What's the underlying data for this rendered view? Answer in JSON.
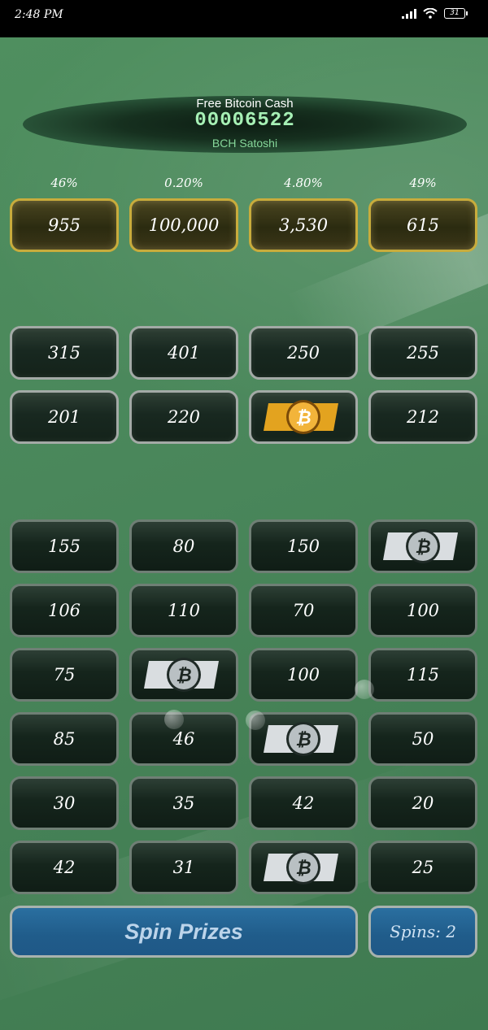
{
  "status_bar": {
    "time": "2:48 PM",
    "battery": "31"
  },
  "header": {
    "title": "Free Bitcoin Cash",
    "amount": "00006522",
    "unit": "BCH Satoshi"
  },
  "top_prizes": [
    {
      "percent": "46%",
      "value": "955"
    },
    {
      "percent": "0.20%",
      "value": "100,000"
    },
    {
      "percent": "4.80%",
      "value": "3,530"
    },
    {
      "percent": "49%",
      "value": "615"
    }
  ],
  "silver_rows": [
    [
      "315",
      "401",
      "250",
      "255"
    ],
    [
      "201",
      "220",
      "gold-bch-coin",
      "212"
    ]
  ],
  "grid_rows": [
    [
      "155",
      "80",
      "150",
      "bch-coin"
    ],
    [
      "106",
      "110",
      "70",
      "100"
    ],
    [
      "75",
      "bch-coin",
      "100",
      "115"
    ],
    [
      "85",
      "46",
      "bch-coin",
      "50"
    ],
    [
      "30",
      "35",
      "42",
      "20"
    ],
    [
      "42",
      "31",
      "bch-coin",
      "25"
    ]
  ],
  "buttons": {
    "spin_label": "Spin Prizes",
    "spins_label": "Spins: 2"
  },
  "colors": {
    "accent_green": "#a6f0b5",
    "gold_border": "#c8ac3c",
    "button_blue": "#205c8a"
  }
}
